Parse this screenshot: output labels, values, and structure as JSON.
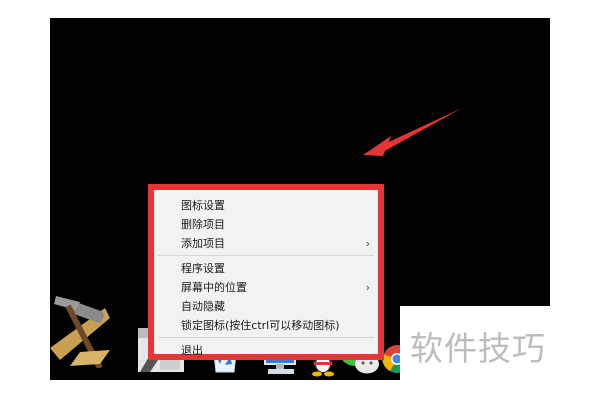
{
  "context_menu": {
    "groups": [
      [
        {
          "label": "图标设置",
          "submenu": false
        },
        {
          "label": "删除项目",
          "submenu": false
        },
        {
          "label": "添加项目",
          "submenu": true
        }
      ],
      [
        {
          "label": "程序设置",
          "submenu": false
        },
        {
          "label": "屏幕中的位置",
          "submenu": true
        },
        {
          "label": "自动隐藏",
          "submenu": false
        },
        {
          "label": "锁定图标(按住ctrl可以移动图标)",
          "submenu": false
        }
      ],
      [
        {
          "label": "退出",
          "submenu": false
        }
      ]
    ],
    "submenu_glyph": "›",
    "highlight_color": "#e53535"
  },
  "annotation": {
    "color": "#e53535"
  },
  "dock": {
    "icons": [
      "tools-icon",
      "package-icon",
      "recycle-bin-icon",
      "computer-icon",
      "qq-penguin-icon",
      "wechat-icon",
      "chrome-icon"
    ]
  },
  "watermark": {
    "text": "软件技巧"
  }
}
